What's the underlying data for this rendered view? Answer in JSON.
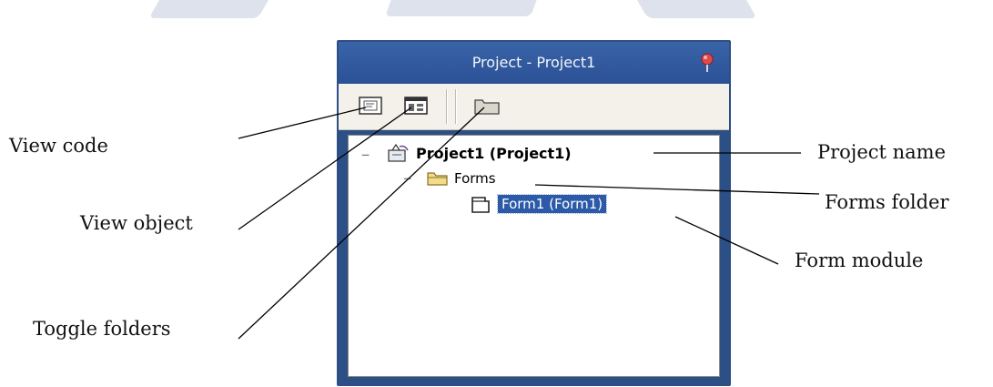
{
  "window": {
    "title": "Project - Project1",
    "title_icon": "pin-icon"
  },
  "toolbar": {
    "buttons": [
      {
        "icon": "view-code-icon"
      },
      {
        "icon": "view-object-icon"
      },
      {
        "icon": "toggle-folders-icon"
      }
    ]
  },
  "tree": {
    "project": {
      "expander": "−",
      "icon": "project-icon",
      "label": "Project1 (Project1)"
    },
    "forms_folder": {
      "expander": "−",
      "icon": "folder-icon",
      "label": "Forms"
    },
    "form": {
      "icon": "form-icon",
      "label": "Form1 (Form1)",
      "selected": true
    }
  },
  "callouts": {
    "view_code": "View code",
    "view_object": "View object",
    "toggle_folders": "Toggle folders",
    "project_name": "Project name",
    "forms_folder": "Forms folder",
    "form_module": "Form module"
  },
  "colors": {
    "panel_border": "#2c4f86",
    "title_bar": "#3a63a8",
    "selection": "#2c5aa8"
  }
}
